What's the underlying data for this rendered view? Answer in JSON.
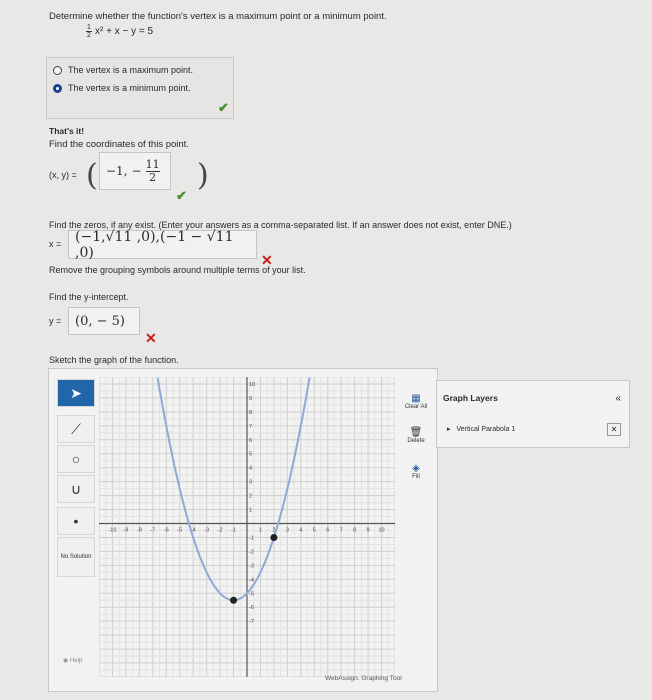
{
  "prompt": "Determine whether the function's vertex is a maximum point or a minimum point.",
  "equation": {
    "frac_num": "1",
    "frac_den": "2",
    "rest": "x² + x − y = 5"
  },
  "choices": [
    {
      "label": "The vertex is a maximum point.",
      "selected": false
    },
    {
      "label": "The vertex is a minimum point.",
      "selected": true
    }
  ],
  "feedback_correct": "That's it!",
  "vertex_question": "Find the coordinates of this point.",
  "vertex_label": "(x, y) =",
  "vertex_answer": {
    "x": "−1,",
    "frac_num": "11",
    "frac_den": "2",
    "minus": "−"
  },
  "zeros_question": "Find the zeros, if any exist. (Enter your answers as a comma-separated list. If an answer does not exist, enter DNE.)",
  "zeros_label": "x =",
  "zeros_answer": "(−1,√11 ,0),(−1 − √11 ,0)",
  "zeros_feedback": "Remove the grouping symbols around multiple terms of your list.",
  "yint_question": "Find the y-intercept.",
  "yint_label": "y =",
  "yint_answer": "(0, − 5)",
  "sketch_prompt": "Sketch the graph of the function.",
  "graph_tool": {
    "tools": [
      "pointer-icon",
      "line-icon",
      "circle-icon",
      "parabola-icon",
      "point-icon",
      "no-solution"
    ],
    "no_solution_label": "No Solution",
    "help_label": "Help",
    "clear_label": "Clear All",
    "delete_label": "Delete",
    "fill_label": "Fill",
    "brand": "WebAssign. Graphing Tool",
    "x_ticks": [
      "-10",
      "-9",
      "-8",
      "-7",
      "-6",
      "-5",
      "-4",
      "-3",
      "-2",
      "-1",
      "1",
      "2",
      "3",
      "4",
      "5",
      "6",
      "7",
      "8",
      "9",
      "10"
    ],
    "y_ticks": [
      "10",
      "9",
      "8",
      "7",
      "6",
      "5",
      "4",
      "3",
      "2",
      "1",
      "-1",
      "-2",
      "-3",
      "-4",
      "-5",
      "-6",
      "-7"
    ],
    "vertex_point": [
      -1,
      -5.5
    ],
    "plotted_point": [
      2,
      -1
    ],
    "curve_color": "#8fa9d6",
    "point_color": "#222222"
  },
  "layers": {
    "title": "Graph Layers",
    "collapse": "«",
    "item": "Vertical Parabola 1",
    "bullet": "▸",
    "remove": "✕"
  }
}
